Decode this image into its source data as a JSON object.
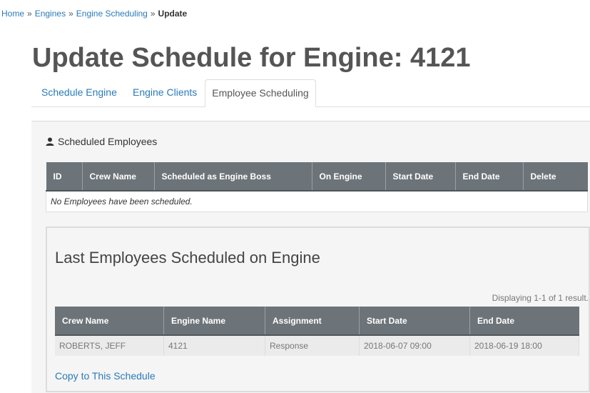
{
  "breadcrumb": {
    "items": [
      "Home",
      "Engines",
      "Engine Scheduling"
    ],
    "current": "Update",
    "separator": "»"
  },
  "page_title": "Update Schedule for Engine: 4121",
  "tabs": [
    {
      "label": "Schedule Engine",
      "active": false
    },
    {
      "label": "Engine Clients",
      "active": false
    },
    {
      "label": "Employee Scheduling",
      "active": true
    }
  ],
  "scheduled": {
    "heading": "Scheduled Employees",
    "icon": "user-icon",
    "columns": [
      "ID",
      "Crew Name",
      "Scheduled as Engine Boss",
      "On Engine",
      "Start Date",
      "End Date",
      "Delete"
    ],
    "empty_message": "No Employees have been scheduled."
  },
  "last_scheduled": {
    "title": "Last Employees Scheduled on Engine",
    "summary": "Displaying 1-1 of 1 result.",
    "columns": [
      "Crew Name",
      "Engine Name",
      "Assignment",
      "Start Date",
      "End Date"
    ],
    "rows": [
      [
        "ROBERTS, JEFF",
        "4121",
        "Response",
        "2018-06-07 09:00",
        "2018-06-19 18:00"
      ]
    ],
    "copy_link": "Copy to This Schedule"
  },
  "colors": {
    "link": "#2a7ab8",
    "table_header": "#6d7479",
    "title": "#555555"
  }
}
